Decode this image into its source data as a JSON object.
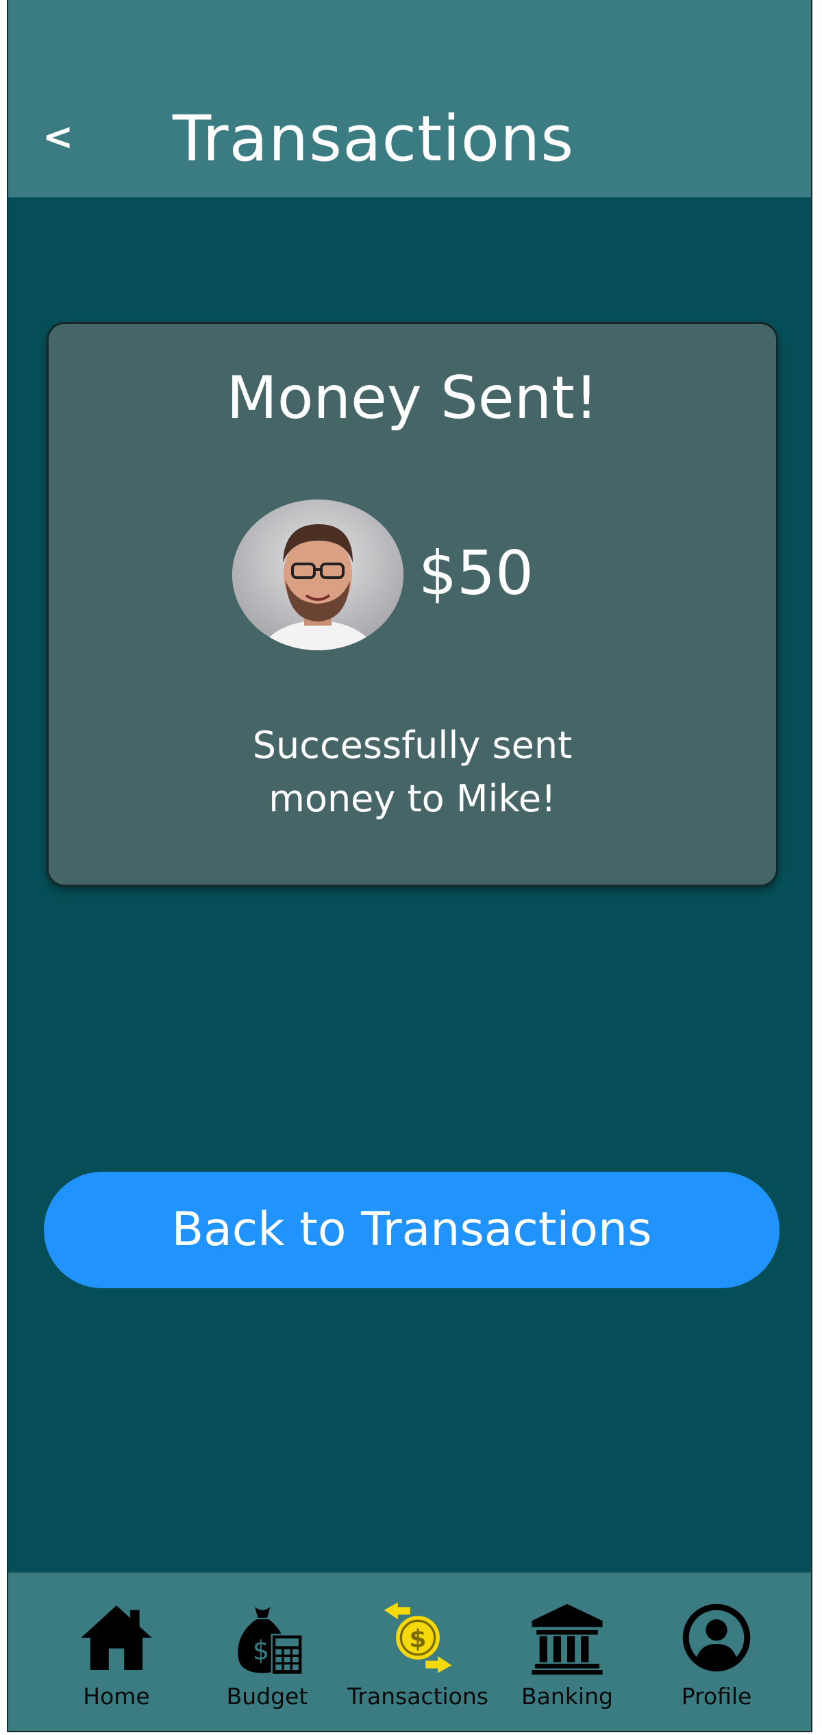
{
  "header": {
    "back_glyph": "<",
    "title": "Transactions"
  },
  "confirmation": {
    "title": "Money Sent!",
    "amount": "$50",
    "message": "Successfully sent\nmoney to Mike!",
    "recipient_avatar": "avatar-photo"
  },
  "actions": {
    "back_button_label": "Back to Transactions"
  },
  "tabbar": {
    "items": [
      {
        "label": "Home",
        "icon": "home-icon",
        "active": false
      },
      {
        "label": "Budget",
        "icon": "money-bag-calculator-icon",
        "active": false
      },
      {
        "label": "Transactions",
        "icon": "dollar-exchange-icon",
        "active": true
      },
      {
        "label": "Banking",
        "icon": "bank-icon",
        "active": false
      },
      {
        "label": "Profile",
        "icon": "profile-icon",
        "active": false
      }
    ]
  },
  "colors": {
    "background": "#064e57",
    "header": "#3a7c82",
    "card": "#456567",
    "button": "#2193fd",
    "active_icon": "#f5d90a"
  }
}
